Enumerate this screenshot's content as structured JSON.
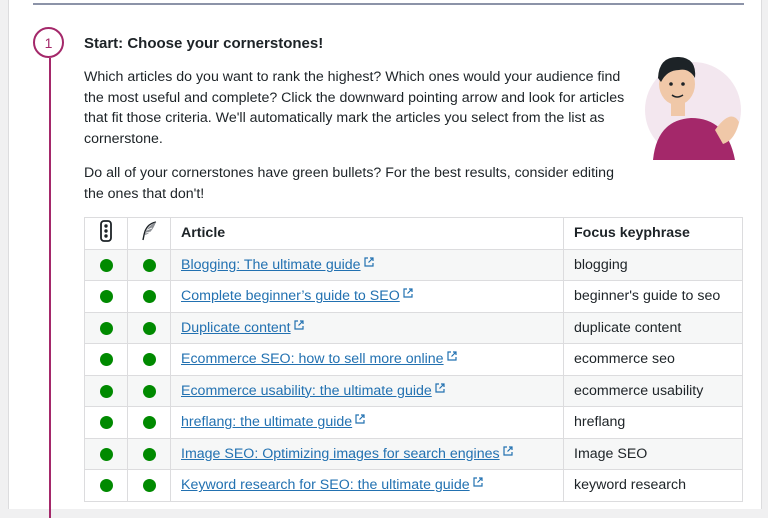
{
  "step": {
    "number": "1",
    "title": "Start: Choose your cornerstones!",
    "paragraph1": "Which articles do you want to rank the highest? Which ones would your audience find the most useful and complete? Click the downward pointing arrow and look for articles that fit those criteria. We'll automatically mark the articles you select from the list as cornerstone.",
    "paragraph2": "Do all of your cornerstones have green bullets? For the best results, consider editing the ones that don't!"
  },
  "table": {
    "headers": {
      "seo_icon": "traffic-light-icon",
      "readability_icon": "feather-icon",
      "article": "Article",
      "keyphrase": "Focus keyphrase"
    },
    "rows": [
      {
        "article": "Blogging: The ultimate guide",
        "keyphrase": "blogging",
        "seo": "good",
        "readability": "good"
      },
      {
        "article": "Complete beginner’s guide to SEO",
        "keyphrase": "beginner's guide to seo",
        "seo": "good",
        "readability": "good"
      },
      {
        "article": "Duplicate content",
        "keyphrase": "duplicate content",
        "seo": "good",
        "readability": "good"
      },
      {
        "article": "Ecommerce SEO: how to sell more online",
        "keyphrase": "ecommerce seo",
        "seo": "good",
        "readability": "good"
      },
      {
        "article": "Ecommerce usability: the ultimate guide",
        "keyphrase": "ecommerce usability",
        "seo": "good",
        "readability": "good"
      },
      {
        "article": "hreflang: the ultimate guide",
        "keyphrase": "hreflang",
        "seo": "good",
        "readability": "good"
      },
      {
        "article": "Image SEO: Optimizing images for search engines",
        "keyphrase": "Image SEO",
        "seo": "good",
        "readability": "good"
      },
      {
        "article": "Keyword research for SEO: the ultimate guide",
        "keyphrase": "keyword research",
        "seo": "good",
        "readability": "good"
      }
    ]
  },
  "colors": {
    "accent": "#a4286a",
    "good_bullet": "#008a00",
    "link": "#2271b1"
  }
}
